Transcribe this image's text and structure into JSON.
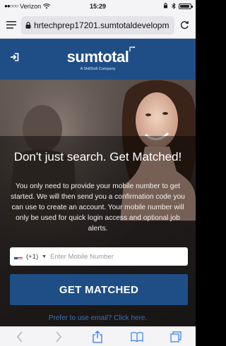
{
  "status_bar": {
    "carrier": "Verizon",
    "time": "15:29"
  },
  "browser": {
    "url": "hrtechprep17201.sumtotaldevelopm"
  },
  "header": {
    "logo_text": "sumtotal",
    "logo_subtext": "A SkillSoft Company",
    "brand_color": "#1f4e86"
  },
  "hero": {
    "headline": "Don't just search. Get Matched!",
    "body": "You only need to provide your mobile number to get started. We will then send you a confirmation code you can use to create an account. Your mobile number will only be used for quick login access and optional job alerts.",
    "country_code": "(+1)",
    "phone_placeholder": "Enter Mobile Number",
    "cta_label": "GET MATCHED",
    "email_link": "Prefer to use email? Click here."
  },
  "icons": {
    "reader": "reader-icon",
    "lock": "lock-icon",
    "reload": "reload-icon",
    "signin": "sign-in-icon",
    "back": "back-icon",
    "forward": "forward-icon",
    "share": "share-icon",
    "bookmarks": "bookmarks-icon",
    "tabs": "tabs-icon"
  }
}
